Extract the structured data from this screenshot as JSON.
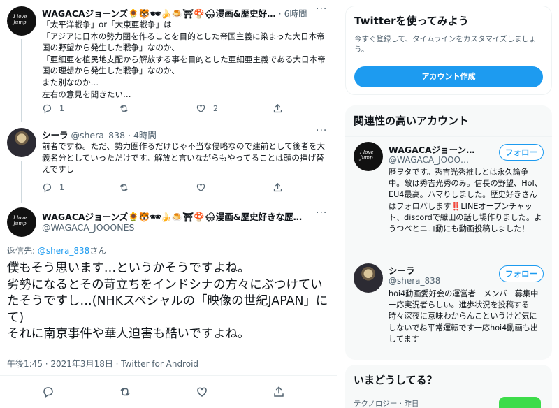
{
  "tweet1": {
    "avatar_text": "I love\nJump",
    "name": "WAGACAジョーンズ🌻🐯🕶🍌🍮⛩🍄🌨漫画&歴史好…",
    "time": "· 6時間",
    "text": "「太平洋戦争」or「大東亜戦争」は\n「アジアに日本の勢力圏を作ることを目的とした帝国主義に染まった大日本帝国の野望から発生した戦争」なのか、\n「亜細亜を植民地支配から解放する事を目的とした亜細亜主義である大日本帝国の理想から発生した戦争」なのか、\nまた別なのか…\n左右の意見を聞きたい…",
    "replies": "1",
    "retweets": "",
    "likes": "2"
  },
  "tweet2": {
    "name": "シーラ",
    "handle": "@shera_838",
    "time": "· 4時間",
    "text": "前者ですね。ただ、勢力圏作るだけじゃ不当な侵略なので建前として後者を大義名分としていっただけです。解放と言いながらもやってることは頭の挿げ替えですし",
    "replies": "1",
    "retweets": "",
    "likes": ""
  },
  "main_tweet": {
    "avatar_text": "I love\nJump",
    "name": "WAGACAジョーンズ🌻🐯🕶🍌🍮⛩🍄🌨漫画&歴史好きな歴…",
    "handle": "@WAGACA_JOOONES",
    "reply_prefix": "返信先: ",
    "reply_to": "@shera_838",
    "reply_suffix": "さん",
    "text": "僕もそう思います…というかそうですよね。\n劣勢になるとその苛立ちをインドシナの方々にぶつけていたそうですし…(NHKスペシャルの「映像の世紀JAPAN」にて)\nそれに南京事件や華人迫害も酷いですよね。",
    "meta": "午後1:45 · 2021年3月18日 · Twitter for Android"
  },
  "signup": {
    "title": "Twitterを使ってみよう",
    "desc": "今すぐ登録して、タイムラインをカスタマイズしましょう。",
    "button": "アカウント作成"
  },
  "relevant": {
    "title": "関連性の高いアカウント",
    "follow_label": "フォロー",
    "accounts": [
      {
        "avatar_text": "I love\nJump",
        "name": "WAGACAジョーン…",
        "handle": "@WAGACA_JOOO…",
        "bio": "歴ヲタです。秀吉光秀推しとは永久論争中。敵は秀吉光秀のみ。信長の野望、HoI、EU4最高。ハマりしました。歴史好きさんはフォロバします‼️LINEオープンチャット、discordで織田の話し場作りました。ようつべとニコ動にも動画投稿しました！"
      },
      {
        "name": "シーラ",
        "handle": "@shera_838",
        "bio": "hoi4動画愛好会の運営者　メンバー募集中一応実況者らしい。進歩状況を投稿する時々深夜に意味わからんこというけど気にしないでね平常運転です一応hoi4動画も出してます"
      }
    ]
  },
  "trends": {
    "title": "いまどうしてる？",
    "item_meta": "テクノロジー · 昨日"
  }
}
